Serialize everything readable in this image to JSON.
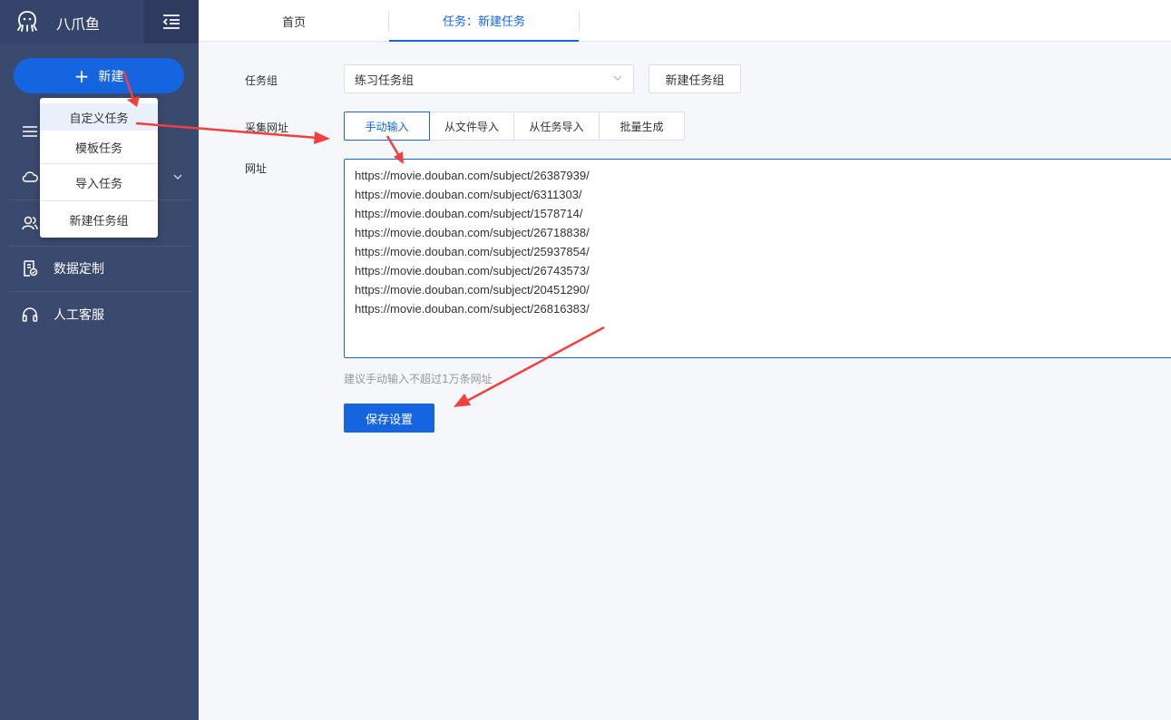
{
  "sidebar": {
    "title": "八爪鱼",
    "new_label": "新建",
    "items": [
      {
        "label": "数据定制"
      },
      {
        "label": "人工客服"
      }
    ]
  },
  "dropdown": {
    "items": [
      {
        "label": "自定义任务"
      },
      {
        "label": "模板任务"
      },
      {
        "label": "导入任务"
      },
      {
        "label": "新建任务组"
      }
    ]
  },
  "tabs": [
    {
      "label": "首页"
    },
    {
      "label": "任务：新建任务"
    }
  ],
  "form": {
    "group_label": "任务组",
    "group_value": "练习任务组",
    "new_group_button": "新建任务组",
    "source_label": "采集网址",
    "source_options": [
      "手动输入",
      "从文件导入",
      "从任务导入",
      "批量生成"
    ],
    "url_label": "网址",
    "urls": [
      "https://movie.douban.com/subject/26387939/",
      "https://movie.douban.com/subject/6311303/",
      "https://movie.douban.com/subject/1578714/",
      "https://movie.douban.com/subject/26718838/",
      "https://movie.douban.com/subject/25937854/",
      "https://movie.douban.com/subject/26743573/",
      "https://movie.douban.com/subject/20451290/",
      "https://movie.douban.com/subject/26816383/"
    ],
    "hint": "建议手动输入不超过1万条网址",
    "save_button": "保存设置"
  },
  "colors": {
    "sidebar_bg": "#3a4a6e",
    "accent": "#1565e0",
    "annotation_arrow": "#f04040"
  }
}
